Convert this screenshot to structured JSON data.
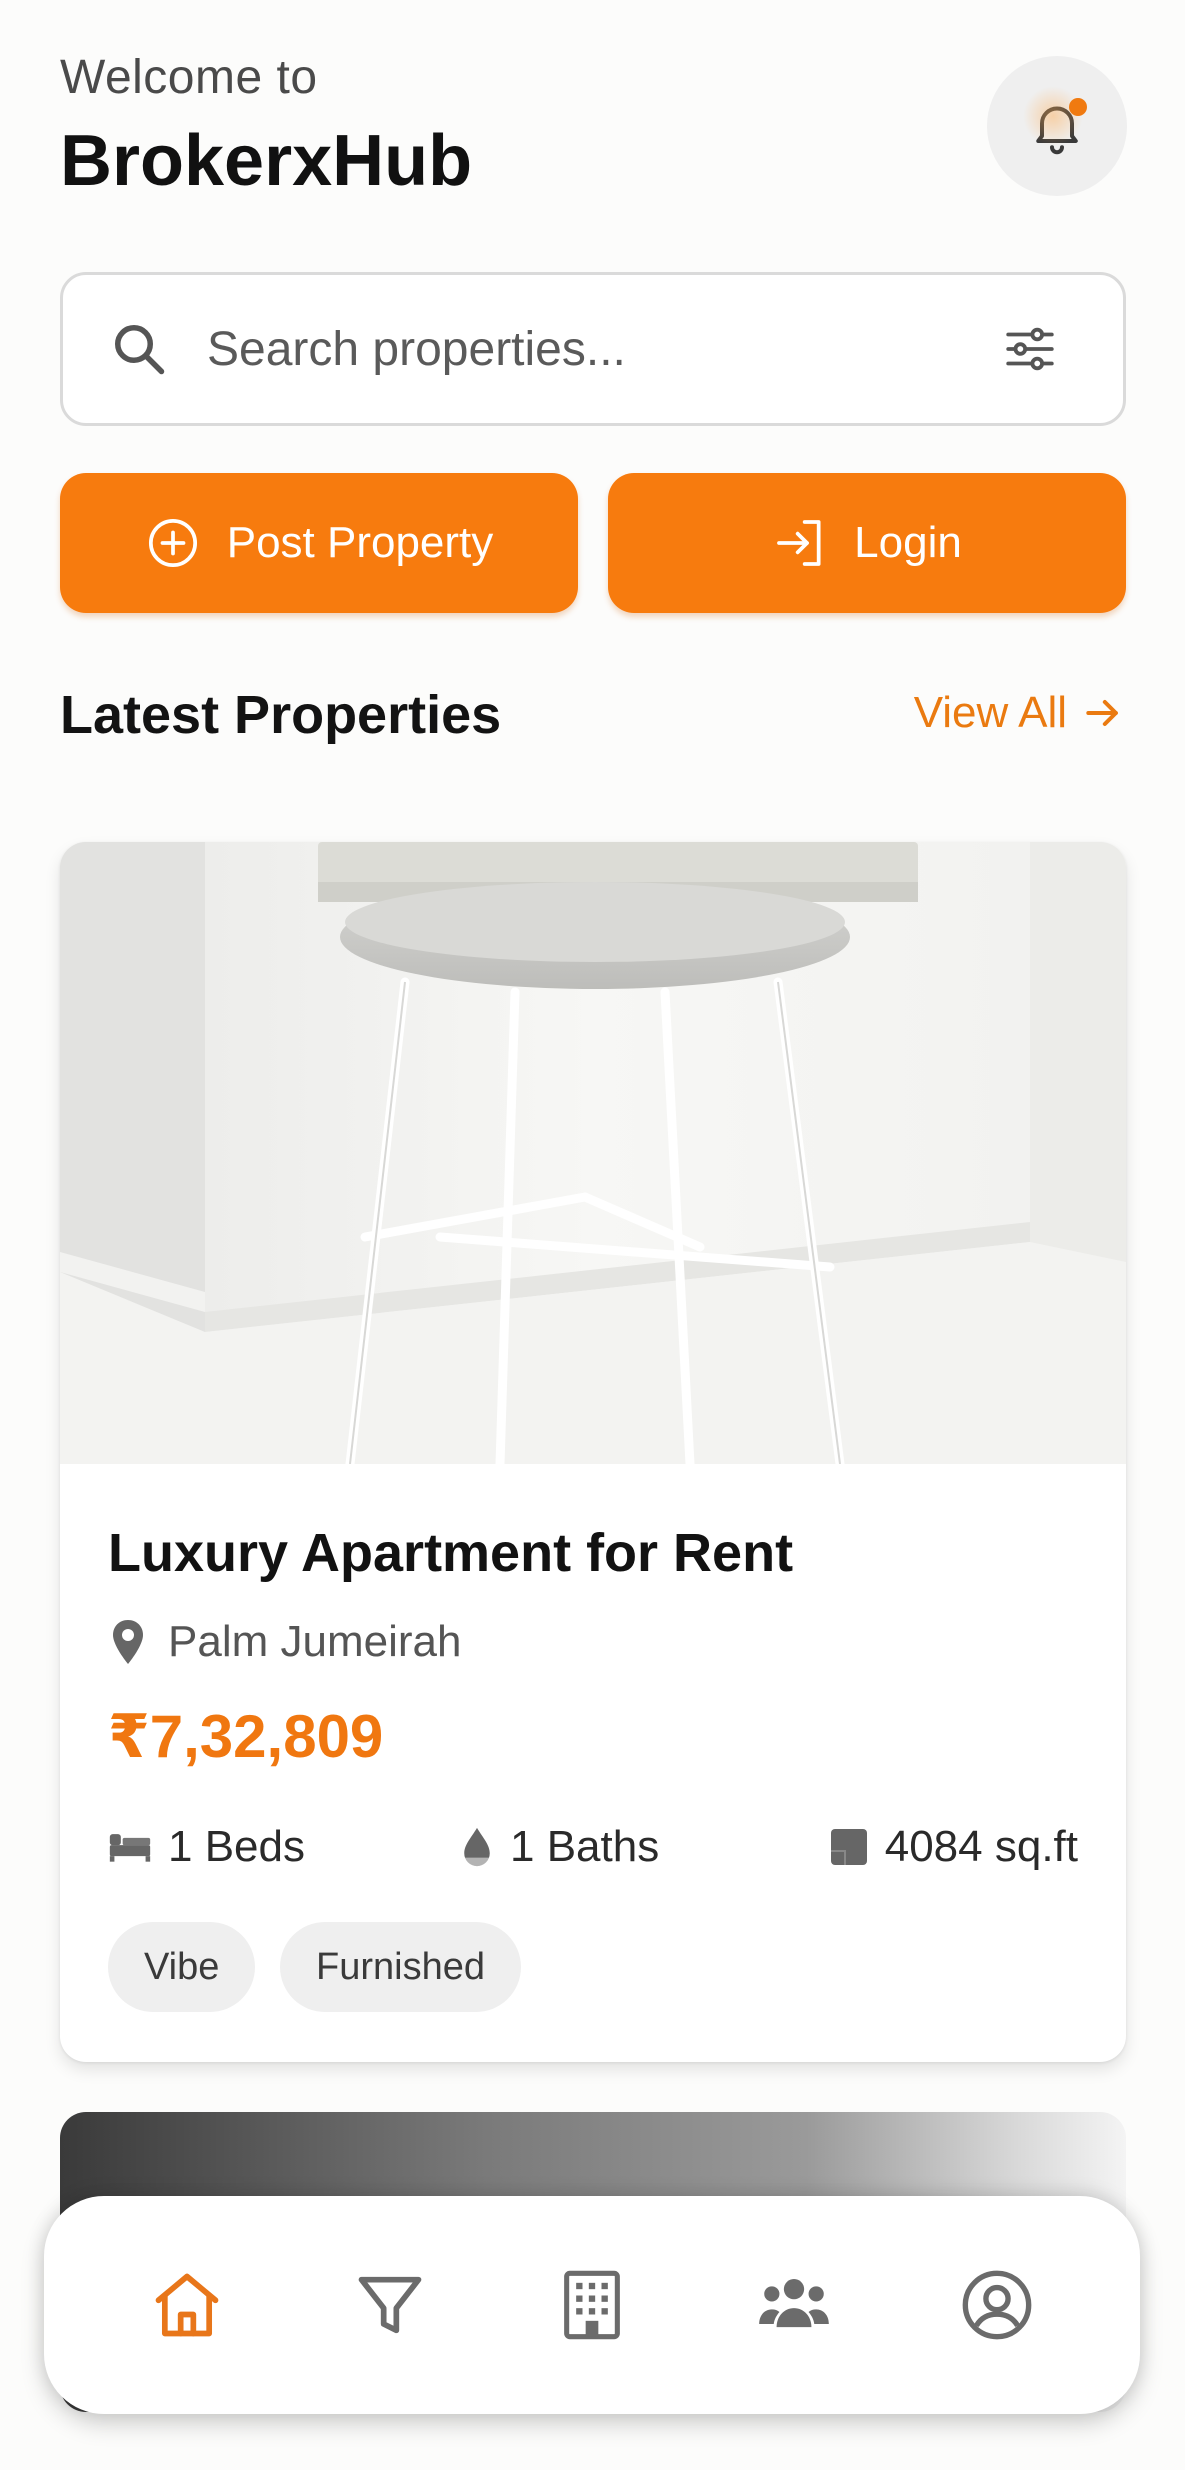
{
  "header": {
    "welcome": "Welcome to",
    "brand": "BrokerxHub"
  },
  "notifications": {
    "icon": "bell-icon",
    "has_unread": true
  },
  "search": {
    "placeholder": "Search properties...",
    "value": "",
    "icon": "search-icon",
    "filter_icon": "sliders-icon"
  },
  "actions": {
    "post_label": "Post Property",
    "post_icon": "plus-circle-icon",
    "login_label": "Login",
    "login_icon": "login-icon"
  },
  "section": {
    "title": "Latest Properties",
    "view_all": "View All"
  },
  "listings": [
    {
      "title": "Luxury Apartment for Rent",
      "location": "Palm Jumeirah",
      "price": "₹7,32,809",
      "beds": "1 Beds",
      "baths": "1 Baths",
      "area": "4084 sq.ft",
      "tags": [
        "Vibe",
        "Furnished"
      ]
    }
  ],
  "bottom_nav": [
    {
      "name": "home",
      "icon": "home-icon",
      "active": true
    },
    {
      "name": "filter",
      "icon": "filter-icon",
      "active": false
    },
    {
      "name": "properties",
      "icon": "building-icon",
      "active": false
    },
    {
      "name": "community",
      "icon": "users-icon",
      "active": false
    },
    {
      "name": "profile",
      "icon": "user-circle-icon",
      "active": false
    }
  ],
  "colors": {
    "accent": "#f77b0e",
    "nav_active": "#e8761a",
    "nav_inactive": "#6b6b6b"
  }
}
